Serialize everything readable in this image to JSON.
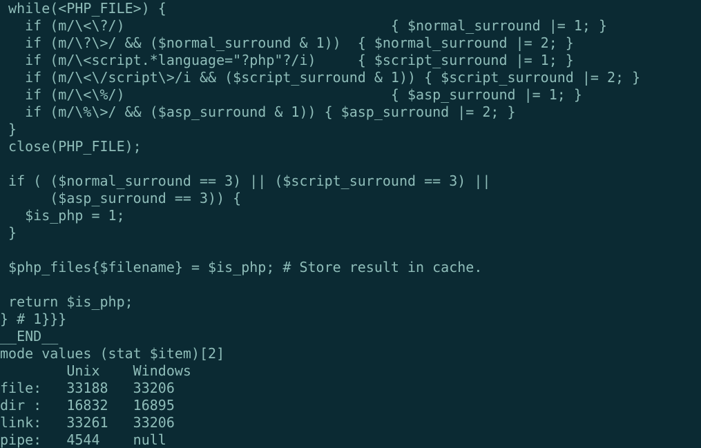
{
  "code": {
    "lines": [
      " while(<PHP_FILE>) {",
      "   if (m/\\<\\?/)                                { $normal_surround |= 1; }",
      "   if (m/\\?\\>/ && ($normal_surround & 1))  { $normal_surround |= 2; }",
      "   if (m/\\<script.*language=\"?php\"?/i)     { $script_surround |= 1; }",
      "   if (m/\\<\\/script\\>/i && ($script_surround & 1)) { $script_surround |= 2; }",
      "   if (m/\\<\\%/)                                { $asp_surround |= 1; }",
      "   if (m/\\%\\>/ && ($asp_surround & 1)) { $asp_surround |= 2; }",
      " }",
      " close(PHP_FILE);",
      "",
      " if ( ($normal_surround == 3) || ($script_surround == 3) ||",
      "      ($asp_surround == 3)) {",
      "   $is_php = 1;",
      " }",
      "",
      " $php_files{$filename} = $is_php; # Store result in cache.",
      "",
      " return $is_php;",
      "} # 1}}}",
      "__END__",
      "mode values (stat $item)[2]",
      "        Unix    Windows",
      "file:   33188   33206",
      "dir :   16832   16895",
      "link:   33261   33206",
      "pipe:   4544    null"
    ]
  },
  "chart_data": {
    "type": "table",
    "title": "mode values (stat $item)[2]",
    "columns": [
      "",
      "Unix",
      "Windows"
    ],
    "rows": [
      {
        "label": "file",
        "Unix": 33188,
        "Windows": 33206
      },
      {
        "label": "dir",
        "Unix": 16832,
        "Windows": 16895
      },
      {
        "label": "link",
        "Unix": 33261,
        "Windows": 33206
      },
      {
        "label": "pipe",
        "Unix": 4544,
        "Windows": null
      }
    ]
  },
  "colors": {
    "background": "#0b2a33",
    "foreground": "#8fbdb9"
  }
}
